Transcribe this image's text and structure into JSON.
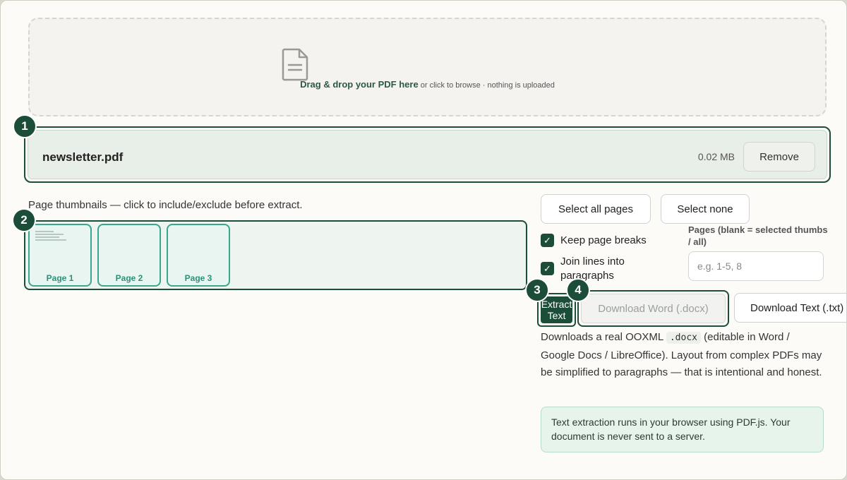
{
  "dropzone": {
    "icon": "document-icon",
    "strong_text": "Drag & drop your PDF here",
    "sub_text": "or click to browse · nothing is uploaded"
  },
  "file": {
    "name": "newsletter.pdf",
    "size": "0.02 MB",
    "remove_label": "Remove"
  },
  "badges": [
    "1",
    "2",
    "3",
    "4"
  ],
  "thumbnails": {
    "label": "Page thumbnails — click to include/exclude before extract.",
    "pages": [
      {
        "label": "Page 1"
      },
      {
        "label": "Page 2"
      },
      {
        "label": "Page 3"
      }
    ]
  },
  "selection": {
    "select_all": "Select all pages",
    "select_none": "Select none"
  },
  "options": {
    "keep_breaks": {
      "label": "Keep page breaks",
      "checked": true
    },
    "join_lines": {
      "label": "Join lines into paragraphs",
      "checked": true
    }
  },
  "pages_field": {
    "label": "Pages (blank = selected thumbs / all)",
    "placeholder": "e.g. 1-5, 8"
  },
  "actions": {
    "extract": "Extract Text",
    "download_word": "Download Word (.docx)",
    "download_text": "Download Text (.txt)"
  },
  "description": {
    "before": "Downloads a real OOXML ",
    "code": ".docx",
    "after": " (editable in Word / Google Docs / LibreOffice). Layout from complex PDFs may be simplified to paragraphs — that is intentional and honest."
  },
  "info": "Text extraction runs in your browser using PDF.js. Your document is never sent to a server.",
  "colors": {
    "accent": "#1c4d38",
    "thumb_border": "#3aa68c",
    "info_bg": "#e6f4ec"
  }
}
